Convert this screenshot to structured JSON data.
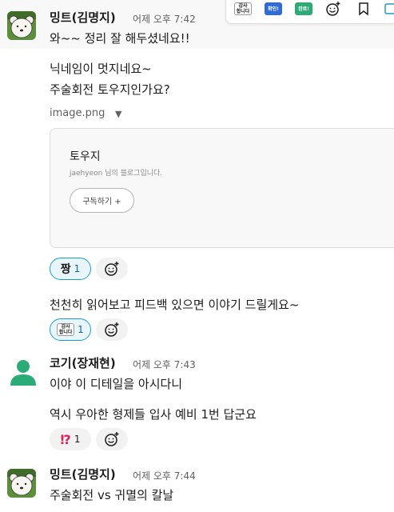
{
  "colors": {
    "accent": "#1264a3",
    "reaction_active_bg": "#e8f5fa",
    "reaction_active_border": "#1d9bd1",
    "excl": "#e01e5a",
    "user_avatar_green": "#2bac76"
  },
  "toolbar": {
    "items": [
      {
        "icon": "reaction-gamsa-emoji",
        "lines": [
          "감사",
          "합니다"
        ]
      },
      {
        "icon": "reaction-hwagin-emoji",
        "label": "확인!"
      },
      {
        "icon": "reaction-wallyo-emoji",
        "label": "완료!"
      },
      {
        "icon": "add-reaction-icon"
      },
      {
        "icon": "bookmark-icon"
      },
      {
        "icon": "more-actions-icon"
      }
    ]
  },
  "messages": [
    {
      "author": "밍트(김명지)",
      "time": "어제 오후 7:42",
      "lines": [
        "와~~ 정리 잘 해두셨네요!!",
        "닉네임이 멋지네요~",
        "주술회전 토우지인가요?"
      ],
      "attachment": {
        "filename": "image.png",
        "card_title": "토우지",
        "card_subtitle": "jaehyeon 님의 블로그입니다.",
        "card_button": "구독하기 +"
      },
      "reactions_1": [
        {
          "emoji": "짱",
          "count": "1",
          "active": true
        }
      ],
      "line_after": "천천히 읽어보고 피드백 있으면 이야기 드릴게요~",
      "reactions_2": [
        {
          "emoji_lines": [
            "감사",
            "합니다"
          ],
          "count": "1",
          "active": true
        }
      ]
    },
    {
      "author": "코기(장재현)",
      "time": "어제 오후 7:43",
      "lines": [
        "이야 이 디테일을 아시다니",
        "역시 우아한 형제들 입사 예비 1번 답군요"
      ],
      "reactions": [
        {
          "emoji": "⁉",
          "count": "1",
          "active": false
        }
      ]
    },
    {
      "author": "밍트(김명지)",
      "time": "어제 오후 7:44",
      "lines": [
        "주술회전 vs 귀멸의 칼날"
      ]
    }
  ]
}
